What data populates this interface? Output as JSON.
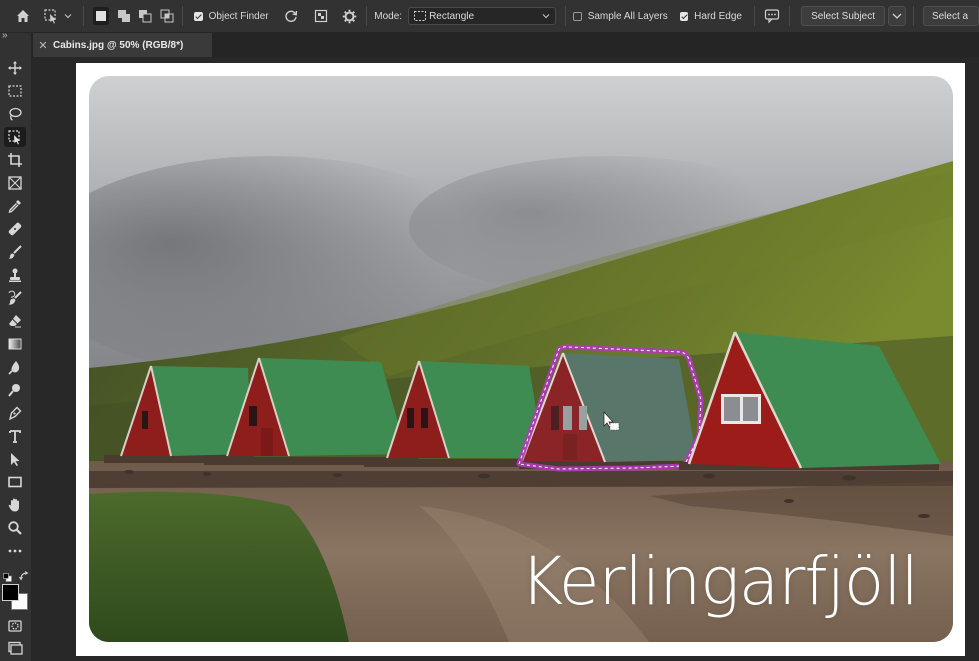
{
  "options_bar": {
    "object_finder_label": "Object Finder",
    "object_finder_checked": true,
    "mode_label": "Mode:",
    "mode_value": "Rectangle",
    "sample_all_layers_label": "Sample All Layers",
    "sample_all_layers_checked": false,
    "hard_edge_label": "Hard Edge",
    "hard_edge_checked": true,
    "select_subject_label": "Select Subject",
    "select_and_mask_label": "Select a"
  },
  "document_tab": {
    "title": "Cabins.jpg @ 50% (RGB/8*)",
    "close_glyph": "✕"
  },
  "collapse_glyph": "»",
  "image": {
    "overlay_text": "Kerlingarfjöll"
  },
  "colors": {
    "foreground": "#000000",
    "background": "#ffffff",
    "selection_highlight": "#b03ab8"
  },
  "tools": [
    "move-tool-icon",
    "marquee-tool-icon",
    "lasso-tool-icon",
    "object-selection-tool-icon",
    "crop-tool-icon",
    "frame-tool-icon",
    "eyedropper-tool-icon",
    "healing-brush-tool-icon",
    "brush-tool-icon",
    "clone-stamp-tool-icon",
    "history-brush-tool-icon",
    "eraser-tool-icon",
    "gradient-tool-icon",
    "blur-tool-icon",
    "dodge-tool-icon",
    "pen-tool-icon",
    "type-tool-icon",
    "path-selection-tool-icon",
    "rectangle-tool-icon",
    "hand-tool-icon",
    "zoom-tool-icon",
    "more-tools-icon"
  ]
}
